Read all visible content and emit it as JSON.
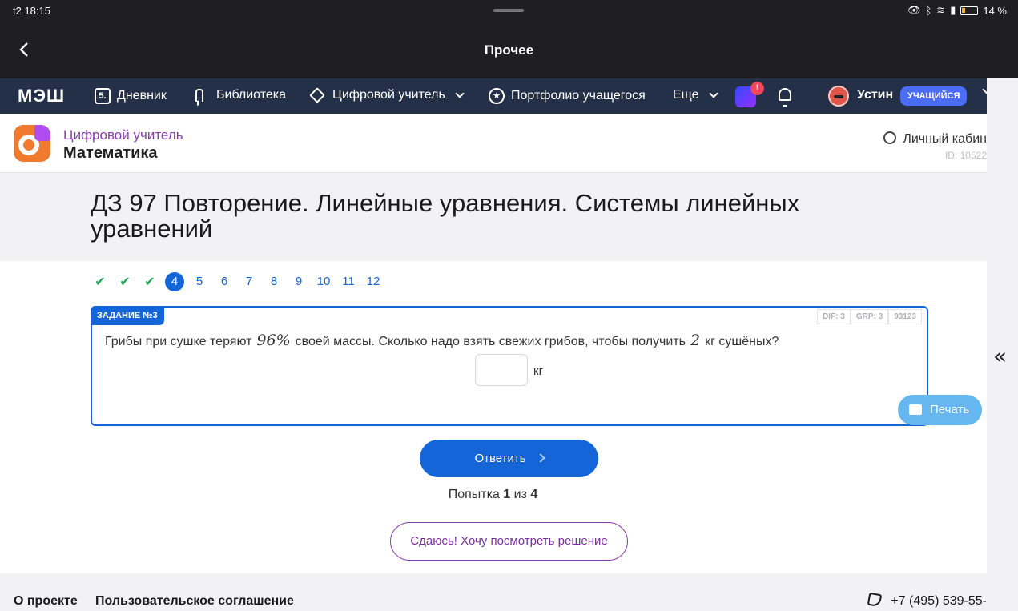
{
  "status_bar": {
    "time": "t2 18:15",
    "battery": "14 %"
  },
  "app_bar": {
    "title": "Прочее"
  },
  "top_nav": {
    "logo": "МЭШ",
    "items": [
      {
        "icon": "diary-icon",
        "icon_text": "5.",
        "label": "Дневник"
      },
      {
        "icon": "bookmark-icon",
        "label": "Библиотека"
      },
      {
        "icon": "cube-icon",
        "label": "Цифровой учитель"
      },
      {
        "icon": "star-icon",
        "label": "Портфолио учащегося"
      },
      {
        "label": "Еще"
      }
    ],
    "notification_badge": "!",
    "user_name": "Устин",
    "role_badge": "УЧАЩИЙСЯ"
  },
  "sub_header": {
    "brand_top": "Цифровой учитель",
    "brand_subject": "Математика",
    "cabinet_label": "Личный кабин",
    "id_text": "ID: 10522"
  },
  "page_title": "ДЗ 97 Повторение. Линейные уравнения. Системы линейных уравнений",
  "steps": [
    {
      "label": "✔",
      "state": "done"
    },
    {
      "label": "✔",
      "state": "done"
    },
    {
      "label": "✔",
      "state": "done"
    },
    {
      "label": "4",
      "state": "active"
    },
    {
      "label": "5",
      "state": "todo"
    },
    {
      "label": "6",
      "state": "todo"
    },
    {
      "label": "7",
      "state": "todo"
    },
    {
      "label": "8",
      "state": "todo"
    },
    {
      "label": "9",
      "state": "todo"
    },
    {
      "label": "10",
      "state": "todo"
    },
    {
      "label": "11",
      "state": "todo"
    },
    {
      "label": "12",
      "state": "todo"
    }
  ],
  "task": {
    "tag": "ЗАДАНИЕ №3",
    "meta": [
      "DIF: 3",
      "GRP: 3",
      "93123"
    ],
    "q_part1": "Грибы при сушке теряют",
    "q_math1": "96%",
    "q_part2": "своей массы. Сколько надо взять свежих грибов, чтобы получить",
    "q_math2": "2",
    "q_part3": "кг сушёных?",
    "answer_value": "",
    "unit": "кг"
  },
  "actions": {
    "submit_label": "Ответить",
    "attempt_prefix": "Попытка",
    "attempt_current": "1",
    "attempt_sep": "из",
    "attempt_total": "4",
    "print_label": "Печать",
    "give_up_label": "Сдаюсь! Хочу посмотреть решение"
  },
  "footer": {
    "about": "О проекте",
    "agreement": "Пользовательское соглашение",
    "phone": "+7 (495) 539-55-"
  },
  "side_panel": {
    "toggle": "«"
  },
  "colors": {
    "accent": "#1466d8",
    "done": "#1ea352",
    "nav_bg": "#233047",
    "brand_purple": "#8a3db0"
  }
}
